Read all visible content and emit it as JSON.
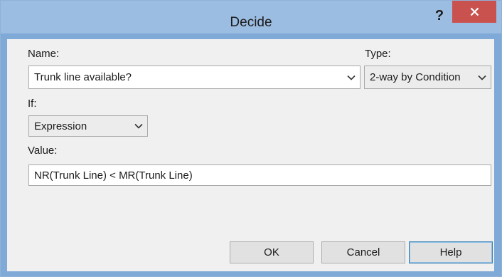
{
  "window": {
    "title": "Decide"
  },
  "titlebar": {
    "help_glyph": "?"
  },
  "fields": {
    "name_label": "Name:",
    "name_value": "Trunk line available?",
    "type_label": "Type:",
    "type_value": "2-way by Condition",
    "if_label": "If:",
    "if_value": "Expression",
    "value_label": "Value:",
    "value_value": "NR(Trunk Line) < MR(Trunk Line)"
  },
  "buttons": {
    "ok": "OK",
    "cancel": "Cancel",
    "help": "Help"
  },
  "icons": {
    "close": "close-icon",
    "dropdown": "chevron-down-icon"
  },
  "colors": {
    "close_button": "#c9524f",
    "titlebar": "#9cbde2",
    "client": "#f0f0f0"
  }
}
